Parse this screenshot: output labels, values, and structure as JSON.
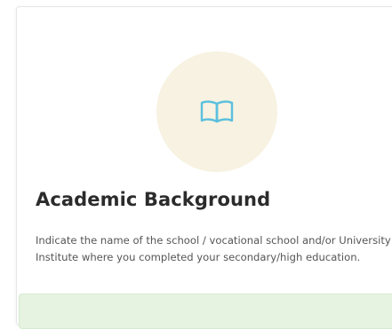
{
  "section": {
    "title": "Academic Background",
    "description": "Indicate the name of the school / vocational school and/or University / Institute where you completed your secondary/high education.",
    "icon": "open-book-icon"
  },
  "colors": {
    "icon_bg": "#f7f2e1",
    "icon_stroke": "#5bc0de",
    "notice_bg": "#e7f3e1"
  }
}
